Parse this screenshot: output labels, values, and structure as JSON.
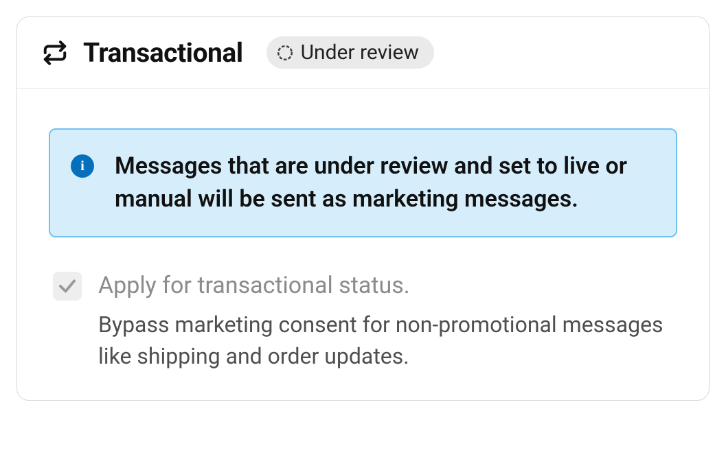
{
  "header": {
    "icon": "transactional-icon",
    "title": "Transactional",
    "status": {
      "icon": "dotted-circle-icon",
      "label": "Under review"
    }
  },
  "callout": {
    "icon": "info-icon",
    "text": "Messages that are under review and set to live or manual will be sent as marketing messages."
  },
  "checkbox": {
    "checked": true,
    "disabled": true,
    "label": "Apply for transactional status.",
    "description": "Bypass marketing consent for non-promotional messages like shipping and order updates."
  }
}
